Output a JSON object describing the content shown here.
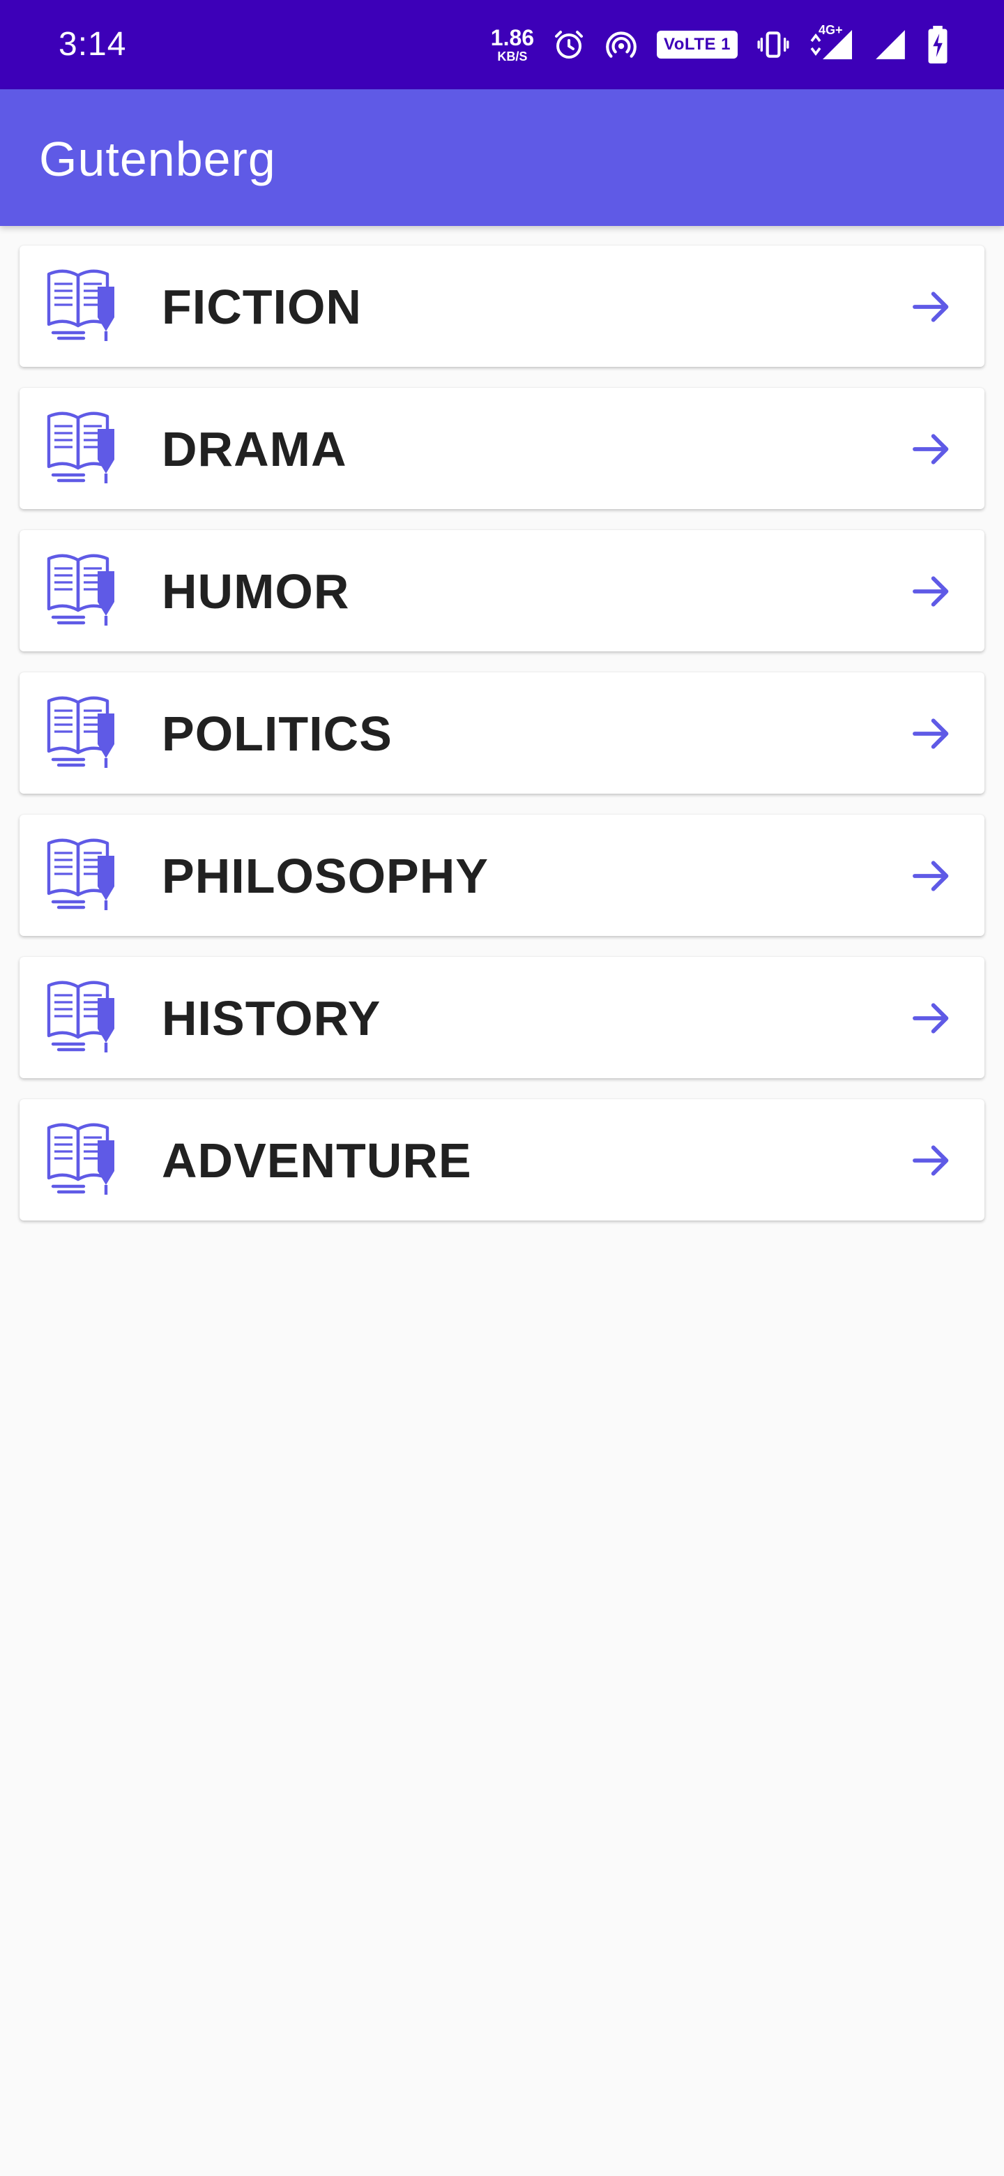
{
  "status_bar": {
    "time": "3:14",
    "net_speed": "1.86",
    "net_speed_unit": "KB/S",
    "volte_label": "VoLTE 1",
    "network_type": "4G+",
    "icons": [
      "alarm-icon",
      "hotspot-icon",
      "vibrate-icon",
      "signal-icon",
      "signal-icon",
      "battery-charging-icon"
    ]
  },
  "app_bar": {
    "title": "Gutenberg"
  },
  "categories": [
    {
      "label": "FICTION",
      "icon": "book-icon",
      "action_icon": "arrow-right-icon"
    },
    {
      "label": "DRAMA",
      "icon": "book-icon",
      "action_icon": "arrow-right-icon"
    },
    {
      "label": "HUMOR",
      "icon": "book-icon",
      "action_icon": "arrow-right-icon"
    },
    {
      "label": "POLITICS",
      "icon": "book-icon",
      "action_icon": "arrow-right-icon"
    },
    {
      "label": "PHILOSOPHY",
      "icon": "book-icon",
      "action_icon": "arrow-right-icon"
    },
    {
      "label": "HISTORY",
      "icon": "book-icon",
      "action_icon": "arrow-right-icon"
    },
    {
      "label": "ADVENTURE",
      "icon": "book-icon",
      "action_icon": "arrow-right-icon"
    }
  ],
  "colors": {
    "status_bar": "#3d00b8",
    "app_bar": "#5f5ae6",
    "accent": "#5f5ae6",
    "background": "#fafafa",
    "card": "#ffffff",
    "text": "#212121"
  }
}
